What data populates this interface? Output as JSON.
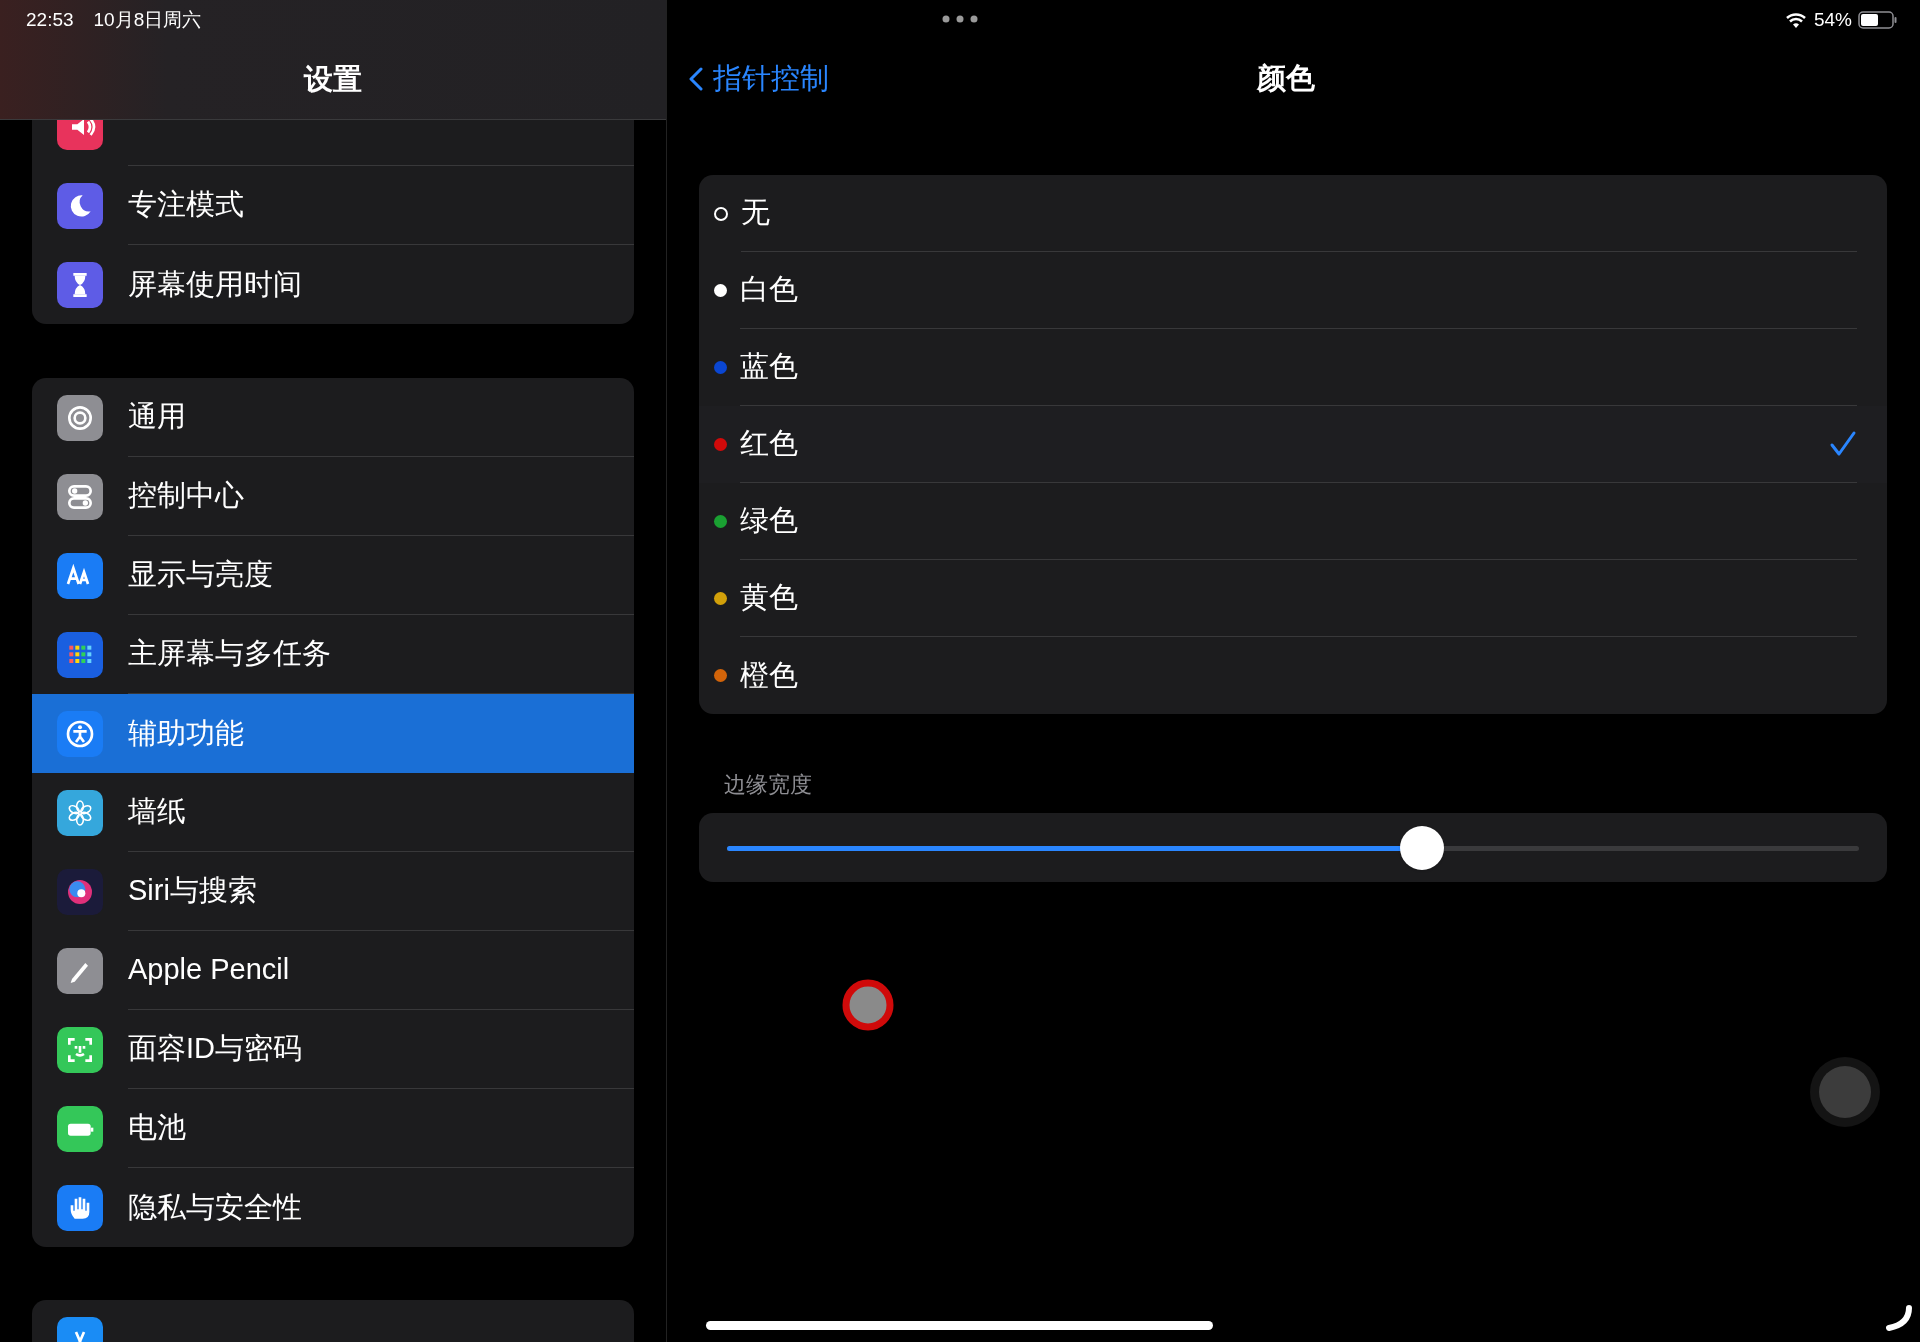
{
  "status_bar": {
    "time": "22:53",
    "date": "10月8日周六",
    "battery": "54%"
  },
  "sidebar": {
    "title": "设置",
    "groups": [
      {
        "items": [
          {
            "selected": false
          },
          {
            "label": "专注模式",
            "selected": false
          },
          {
            "label": "屏幕使用时间",
            "selected": false
          }
        ]
      },
      {
        "items": [
          {
            "label": "通用",
            "selected": false
          },
          {
            "label": "控制中心",
            "selected": false
          },
          {
            "label": "显示与亮度",
            "selected": false
          },
          {
            "label": "主屏幕与多任务",
            "selected": false
          },
          {
            "label": "辅助功能",
            "selected": true
          },
          {
            "label": "墙纸",
            "selected": false
          },
          {
            "label": "Siri与搜索",
            "selected": false
          },
          {
            "label": "Apple Pencil",
            "selected": false
          },
          {
            "label": "面容ID与密码",
            "selected": false
          },
          {
            "label": "电池",
            "selected": false
          },
          {
            "label": "隐私与安全性",
            "selected": false
          }
        ]
      },
      {
        "items": [
          {
            "selected": false
          }
        ]
      }
    ]
  },
  "nav": {
    "back": "指针控制",
    "title": "颜色"
  },
  "colors": [
    {
      "label": "无",
      "kind": "hollow",
      "selected": false
    },
    {
      "label": "白色",
      "kind": "dot",
      "color": "#ffffff",
      "selected": false
    },
    {
      "label": "蓝色",
      "kind": "dot",
      "color": "#0a46d2",
      "selected": false
    },
    {
      "label": "红色",
      "kind": "dot",
      "color": "#d20a0a",
      "selected": true
    },
    {
      "label": "绿色",
      "kind": "dot",
      "color": "#1aa032",
      "selected": false
    },
    {
      "label": "黄色",
      "kind": "dot",
      "color": "#d2a00a",
      "selected": false
    },
    {
      "label": "橙色",
      "kind": "dot",
      "color": "#d2640a",
      "selected": false
    }
  ],
  "border_width": {
    "label": "边缘宽度",
    "level": 0.614
  }
}
